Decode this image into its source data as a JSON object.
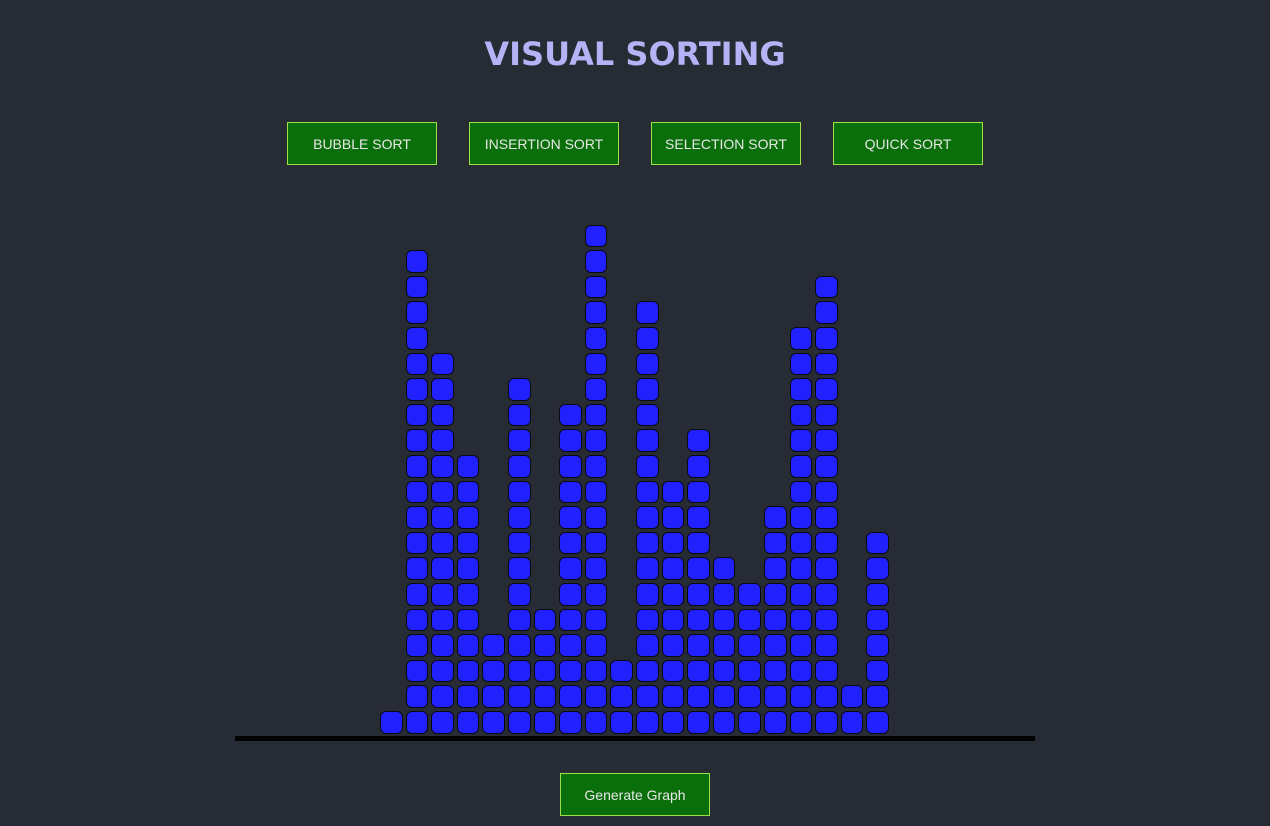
{
  "header": {
    "title": "VISUAL SORTING"
  },
  "sort_buttons": [
    {
      "label": "BUBBLE SORT"
    },
    {
      "label": "INSERTION SORT"
    },
    {
      "label": "SELECTION SORT"
    },
    {
      "label": "QUICK SORT"
    }
  ],
  "controls": {
    "generate_label": "Generate Graph"
  },
  "colors": {
    "background": "#272b34",
    "title": "#b3b3f5",
    "button_bg": "#0a6e0a",
    "button_border": "#9ee04a",
    "block_fill": "#2121ff",
    "baseline": "#000000"
  },
  "graph": {
    "bar_heights": [
      1,
      19,
      15,
      11,
      4,
      14,
      5,
      13,
      20,
      3,
      17,
      10,
      12,
      7,
      6,
      9,
      16,
      18,
      2,
      8
    ]
  }
}
